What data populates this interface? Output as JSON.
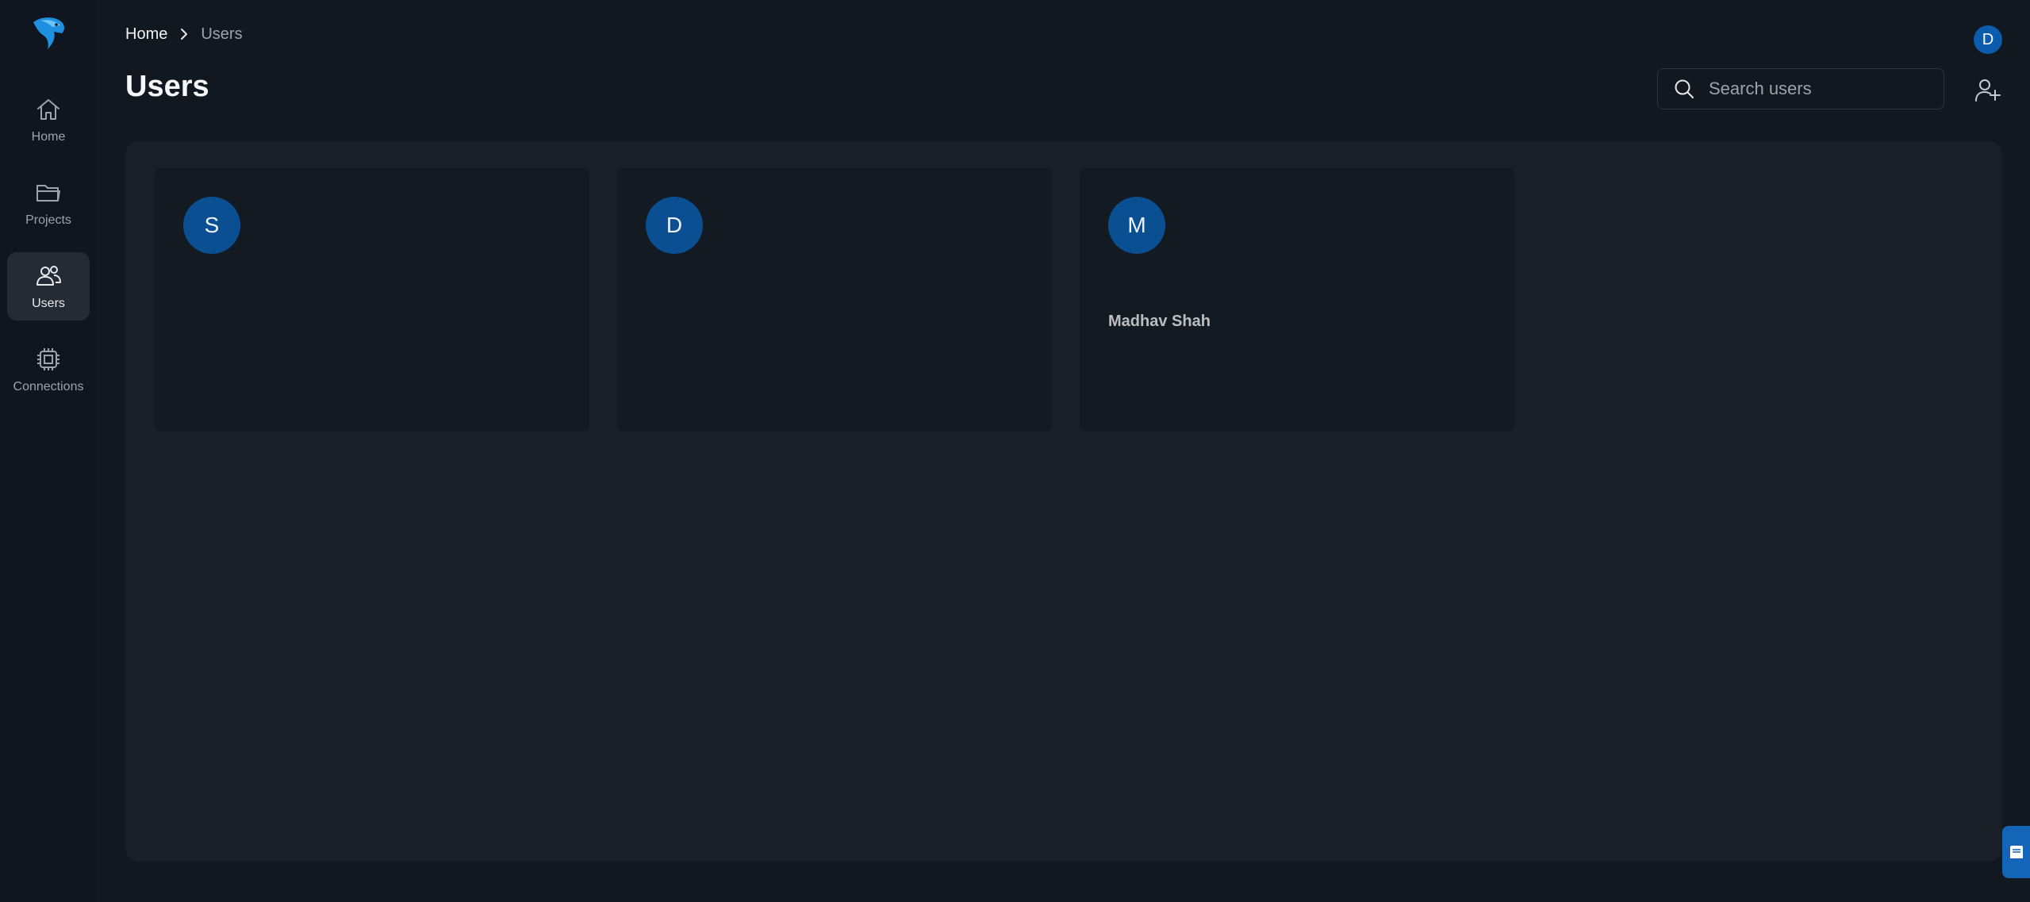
{
  "sidebar": {
    "items": [
      {
        "label": "Home",
        "icon": "home-icon"
      },
      {
        "label": "Projects",
        "icon": "folder-icon"
      },
      {
        "label": "Users",
        "icon": "users-icon",
        "active": true
      },
      {
        "label": "Connections",
        "icon": "chip-icon"
      }
    ]
  },
  "header": {
    "breadcrumb": {
      "home": "Home",
      "current": "Users"
    },
    "title": "Users",
    "avatar_initial": "D"
  },
  "search": {
    "placeholder": "Search users",
    "value": ""
  },
  "users": [
    {
      "initial": "S",
      "name": "",
      "email": ""
    },
    {
      "initial": "D",
      "name": "",
      "email": ""
    },
    {
      "initial": "M",
      "name": "Madhav Shah",
      "email": ""
    }
  ],
  "colors": {
    "background": "#111820",
    "panel": "#1a1f27",
    "card": "#141a22",
    "accent": "#0b5cad"
  }
}
